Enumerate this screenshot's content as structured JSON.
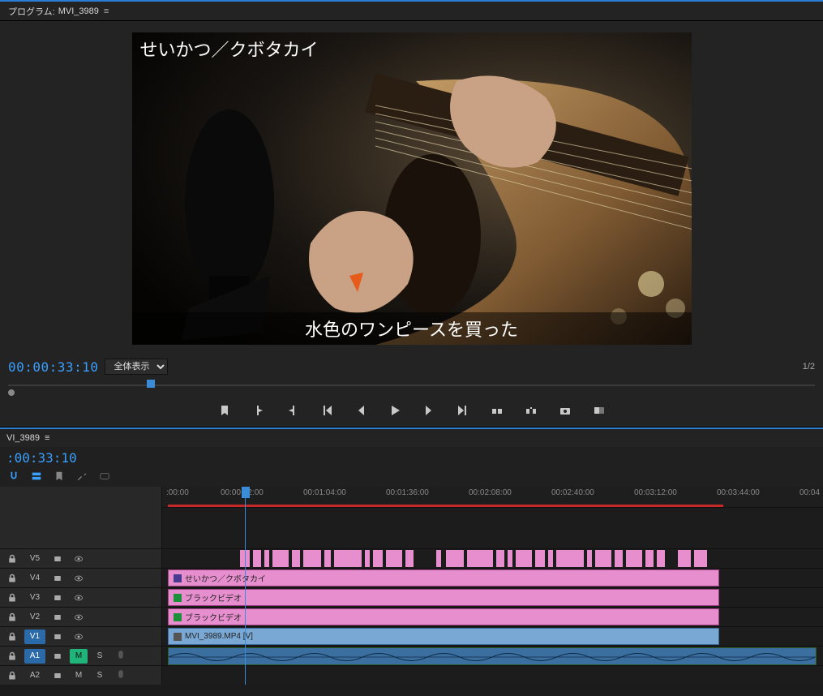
{
  "program": {
    "panel_label_prefix": "プログラム:",
    "clip_name": "MVI_3989",
    "title_overlay": "せいかつ／クボタカイ",
    "subtitle_overlay": "水色のワンピースを買った",
    "timecode": "00:00:33:10",
    "zoom_label": "全体表示",
    "fraction": "1/2"
  },
  "transport": {
    "marker": "marker-icon",
    "in": "mark-in-icon",
    "out": "mark-out-icon",
    "go_in": "goto-in-icon",
    "step_back": "step-back-icon",
    "play": "play-icon",
    "step_fwd": "step-forward-icon",
    "go_out": "goto-out-icon",
    "lift": "lift-icon",
    "extract": "extract-icon",
    "export": "export-frame-icon",
    "compare": "compare-icon"
  },
  "timeline": {
    "sequence_name": "VI_3989",
    "timecode": ":00:33:10",
    "ruler_labels": [
      {
        "pos": 7,
        "t": ":00:00"
      },
      {
        "pos": 74,
        "t": "00:00:32:00"
      },
      {
        "pos": 176,
        "t": "00:01:04:00"
      },
      {
        "pos": 278,
        "t": "00:01:36:00"
      },
      {
        "pos": 380,
        "t": "00:02:08:00"
      },
      {
        "pos": 482,
        "t": "00:02:40:00"
      },
      {
        "pos": 584,
        "t": "00:03:12:00"
      },
      {
        "pos": 686,
        "t": "00:03:44:00"
      },
      {
        "pos": 788,
        "t": "00:04"
      }
    ],
    "tracks": {
      "V5": {
        "label": "V5"
      },
      "V4": {
        "label": "V4",
        "clip": "せいかつ／クボタカイ"
      },
      "V3": {
        "label": "V3",
        "clip": "ブラックビデオ"
      },
      "V2": {
        "label": "V2",
        "clip": "ブラックビデオ"
      },
      "V1": {
        "label": "V1",
        "clip": "MVI_3989.MP4 [V]",
        "selected": true
      },
      "A1": {
        "label": "A1",
        "mute": "M",
        "solo": "S",
        "selected": true
      },
      "A2": {
        "label": "A2",
        "mute": "M",
        "solo": "S"
      }
    },
    "v5_segments": [
      [
        96,
        12
      ],
      [
        112,
        10
      ],
      [
        126,
        6
      ],
      [
        136,
        20
      ],
      [
        160,
        10
      ],
      [
        174,
        22
      ],
      [
        200,
        8
      ],
      [
        212,
        34
      ],
      [
        250,
        6
      ],
      [
        260,
        12
      ],
      [
        276,
        20
      ],
      [
        300,
        10
      ],
      [
        338,
        6
      ],
      [
        350,
        22
      ],
      [
        376,
        32
      ],
      [
        412,
        10
      ],
      [
        426,
        6
      ],
      [
        436,
        20
      ],
      [
        460,
        12
      ],
      [
        476,
        6
      ],
      [
        486,
        34
      ],
      [
        524,
        6
      ],
      [
        534,
        20
      ],
      [
        558,
        10
      ],
      [
        572,
        20
      ],
      [
        596,
        10
      ],
      [
        610,
        10
      ],
      [
        636,
        16
      ],
      [
        656,
        16
      ]
    ]
  }
}
